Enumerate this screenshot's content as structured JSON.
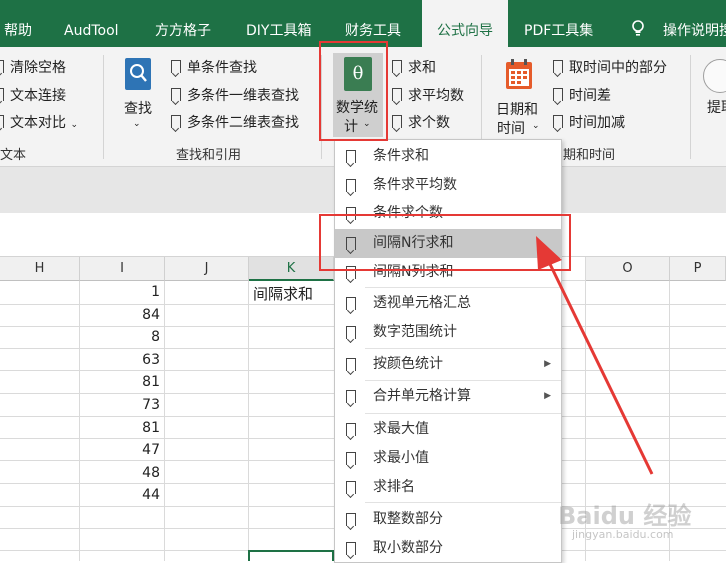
{
  "tabs": [
    "帮助",
    "AudTool",
    "方方格子",
    "DIY工具箱",
    "财务工具",
    "公式向导",
    "PDF工具集",
    "操作说明搜"
  ],
  "ribbon": {
    "text_group": {
      "items": [
        "清除空格",
        "文本连接",
        "文本对比"
      ],
      "label": "文本"
    },
    "lookup_group": {
      "button": "查找",
      "items": [
        "单条件查找",
        "多条件一维表查找",
        "多条件二维表查找"
      ],
      "label": "查找和引用"
    },
    "math_group": {
      "button_line1": "数学统",
      "button_line2": "计",
      "icon_glyph": "θ",
      "items": [
        "求和",
        "求平均数",
        "求个数"
      ]
    },
    "date_group": {
      "button_line1": "日期和",
      "button_line2": "时间",
      "items": [
        "取时间中的部分",
        "时间差",
        "时间加减"
      ],
      "label": "期和时间"
    },
    "extra_button": "提取"
  },
  "grid": {
    "columns": [
      "H",
      "I",
      "J",
      "K",
      "O",
      "P"
    ],
    "i_values": [
      "1",
      "84",
      "8",
      "63",
      "81",
      "73",
      "81",
      "47",
      "48",
      "44"
    ],
    "k1_text": "间隔求和"
  },
  "menu": {
    "items": [
      "条件求和",
      "条件求平均数",
      "条件求个数",
      "间隔N行求和",
      "间隔N列求和",
      "透视单元格汇总",
      "数字范围统计",
      "按颜色统计",
      "合并单元格计算",
      "求最大值",
      "求最小值",
      "求排名",
      "取整数部分",
      "取小数部分"
    ],
    "highlighted_index": 3
  },
  "watermark": {
    "line1": "Baidu 经验",
    "line2": "jingyan.baidu.com"
  },
  "colors": {
    "accent": "#1e7145",
    "annotation": "#e53935"
  }
}
